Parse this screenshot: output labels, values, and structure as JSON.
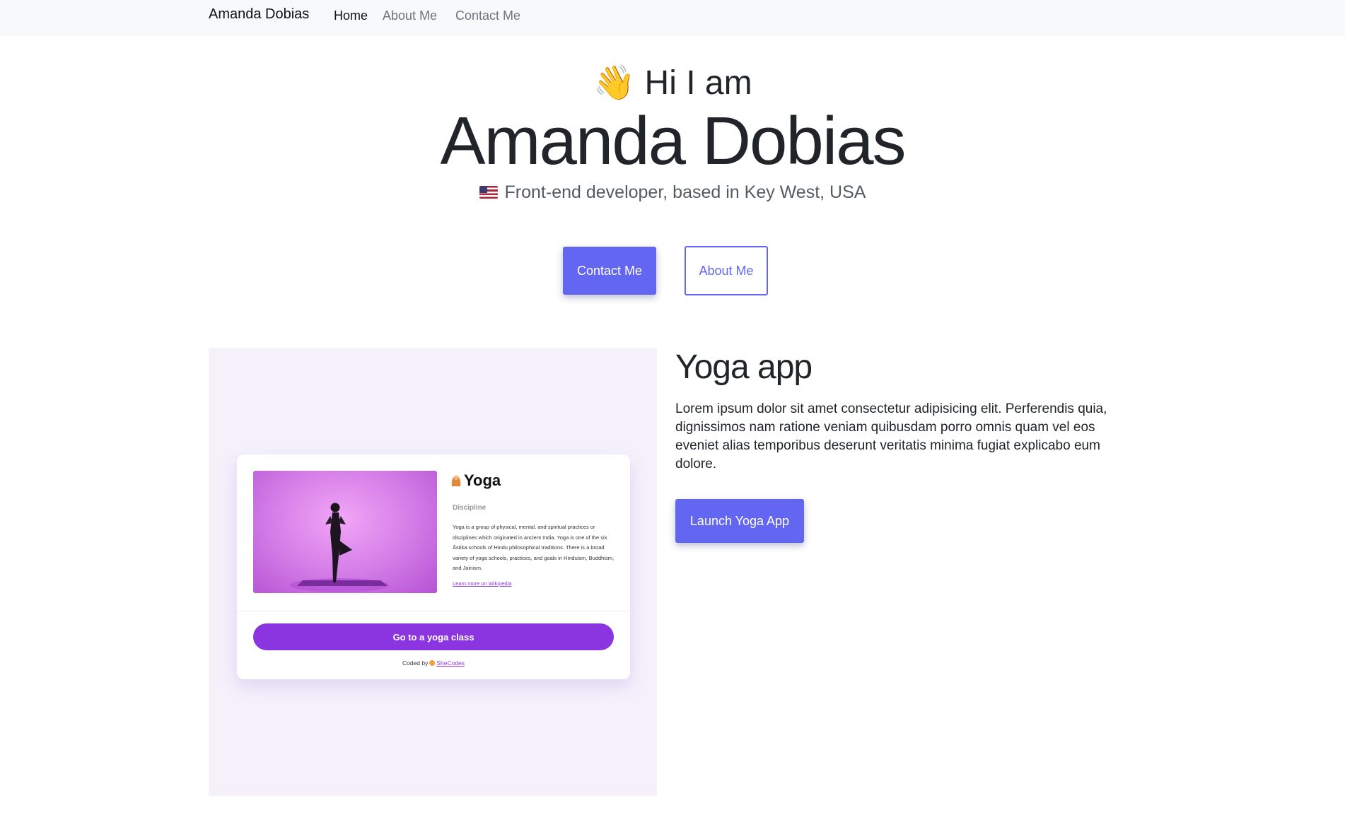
{
  "navbar": {
    "brand": "Amanda Dobias",
    "links": [
      {
        "label": "Home",
        "active": true
      },
      {
        "label": "About Me",
        "active": false
      },
      {
        "label": "Contact Me",
        "active": false
      }
    ]
  },
  "hero": {
    "greeting_emoji": "👋",
    "greeting": "Hi I am",
    "name": "Amanda Dobias",
    "subtitle_flag_icon": "us-flag-icon",
    "subtitle": "Front-end developer, based in Key West, USA",
    "primary_button": "Contact Me",
    "secondary_button": "About Me"
  },
  "project": {
    "title": "Yoga app",
    "description": "Lorem ipsum dolor sit amet consectetur adipisicing elit. Perferendis quia, dignissimos nam ratione veniam quibusdam porro omnis quam vel eos eveniet alias temporibus deserunt veritatis minima fugiat explicabo eum dolore.",
    "button": "Launch Yoga App",
    "preview": {
      "title": "Yoga",
      "emoji_icon": "person-in-lotus-position-icon",
      "subtitle": "Discipline",
      "description": "Yoga is a group of physical, mental, and spiritual practices or disciplines which originated in ancient India. Yoga is one of the six Āstika schools of Hindu philosophical traditions. There is a broad variety of yoga schools, practices, and goals in Hinduism, Buddhism, and Jainism.",
      "link": "Learn more on Wikipedia",
      "button": "Go to a yoga class",
      "coded_by_prefix": "Coded by",
      "coded_by_link": "SheCodes"
    }
  },
  "colors": {
    "accent": "#6366f1",
    "preview_button": "#8b35e0",
    "panel_background": "#f4f1fb",
    "navbar_background": "#f8f9fa"
  }
}
